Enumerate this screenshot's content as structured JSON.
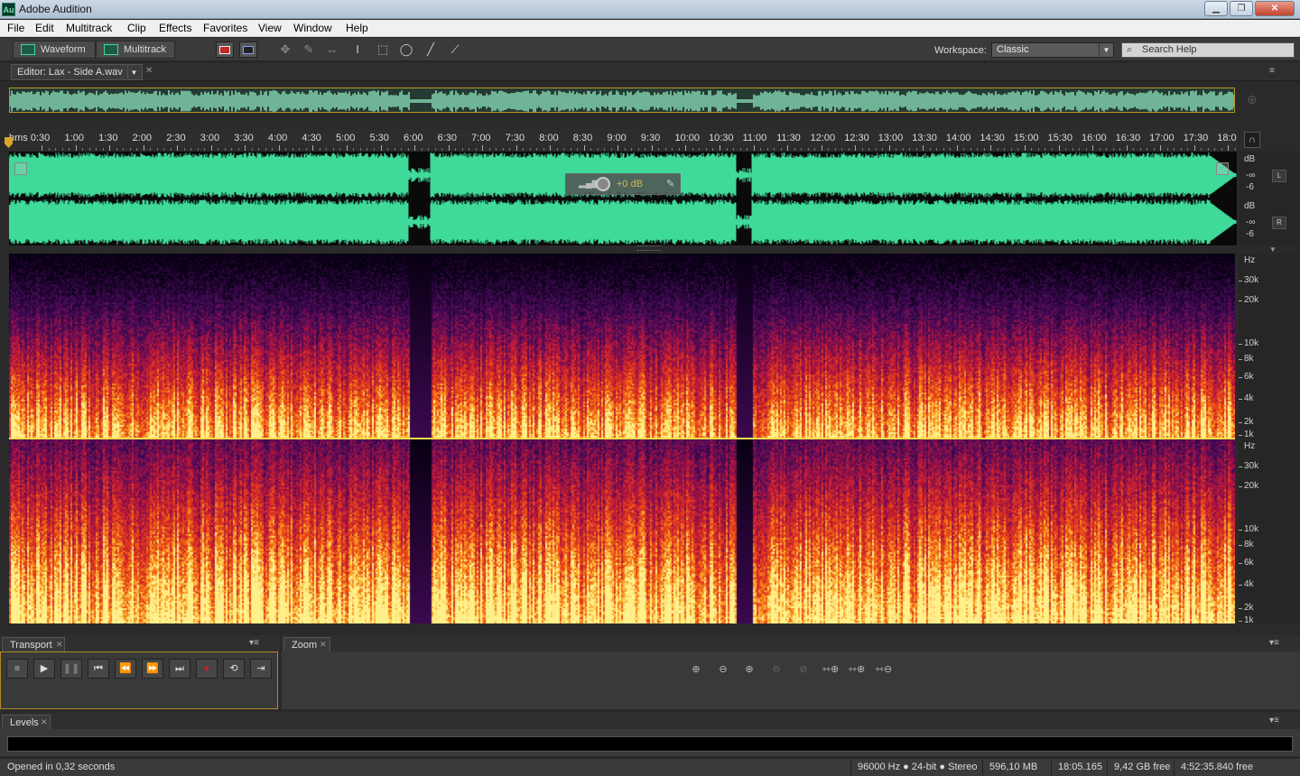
{
  "window": {
    "title": "Adobe Audition",
    "logo": "Au",
    "minimize_icon": "minimize-icon",
    "maximize_icon": "maximize-icon",
    "close_icon": "close-icon"
  },
  "menu": [
    "File",
    "Edit",
    "Multitrack",
    "Clip",
    "Effects",
    "Favorites",
    "View",
    "Window",
    "Help"
  ],
  "toolbar": {
    "waveform_label": "Waveform",
    "multitrack_label": "Multitrack",
    "workspace_label": "Workspace:",
    "workspace_value": "Classic",
    "search_placeholder": "Search Help"
  },
  "editor": {
    "tab_label": "Editor: Lax - Side A.wav",
    "hud_gain": "+0 dB",
    "ruler_ticks": [
      "hms 0:30",
      "1:00",
      "1:30",
      "2:00",
      "2:30",
      "3:00",
      "3:30",
      "4:00",
      "4:30",
      "5:00",
      "5:30",
      "6:00",
      "6:30",
      "7:00",
      "7:30",
      "8:00",
      "8:30",
      "9:00",
      "9:30",
      "10:00",
      "10:30",
      "11:00",
      "11:30",
      "12:00",
      "12:30",
      "13:00",
      "13:30",
      "14:00",
      "14:30",
      "15:00",
      "15:30",
      "16:00",
      "16:30",
      "17:00",
      "17:30",
      "18:0"
    ],
    "db_scale": {
      "unit": "dB",
      "values": [
        "-∞",
        "-6"
      ]
    },
    "channels": [
      "L",
      "R"
    ],
    "hz_scale": {
      "unit": "Hz",
      "values": [
        "30k",
        "20k",
        "10k",
        "8k",
        "6k",
        "4k",
        "2k",
        "1k"
      ]
    },
    "colors": {
      "waveform": "#3fd99a",
      "waveform_bg": "#0a0a0a",
      "overview": "#6fb496",
      "selection_border": "#b8962a"
    }
  },
  "transport": {
    "tab_label": "Transport",
    "buttons": [
      "stop-icon",
      "play-icon",
      "pause-icon",
      "skip-to-start-icon",
      "rewind-icon",
      "fast-forward-icon",
      "skip-to-end-icon",
      "record-icon",
      "loop-icon",
      "skip-selection-icon"
    ]
  },
  "zoom": {
    "tab_label": "Zoom",
    "buttons": [
      "zoom-in-amplitude-icon",
      "zoom-out-amplitude-icon",
      "zoom-in-time-icon",
      "zoom-out-time-icon",
      "zoom-out-full-icon",
      "zoom-to-selection-icon",
      "zoom-in-selection-icon",
      "zoom-out-selection-icon"
    ]
  },
  "levels": {
    "tab_label": "Levels"
  },
  "status": {
    "message": "Opened in 0,32 seconds",
    "format": "96000 Hz ● 24-bit ● Stereo",
    "size": "596,10 MB",
    "duration": "18:05.165",
    "free_space": "9,42 GB free",
    "free_time": "4:52:35.840 free"
  }
}
